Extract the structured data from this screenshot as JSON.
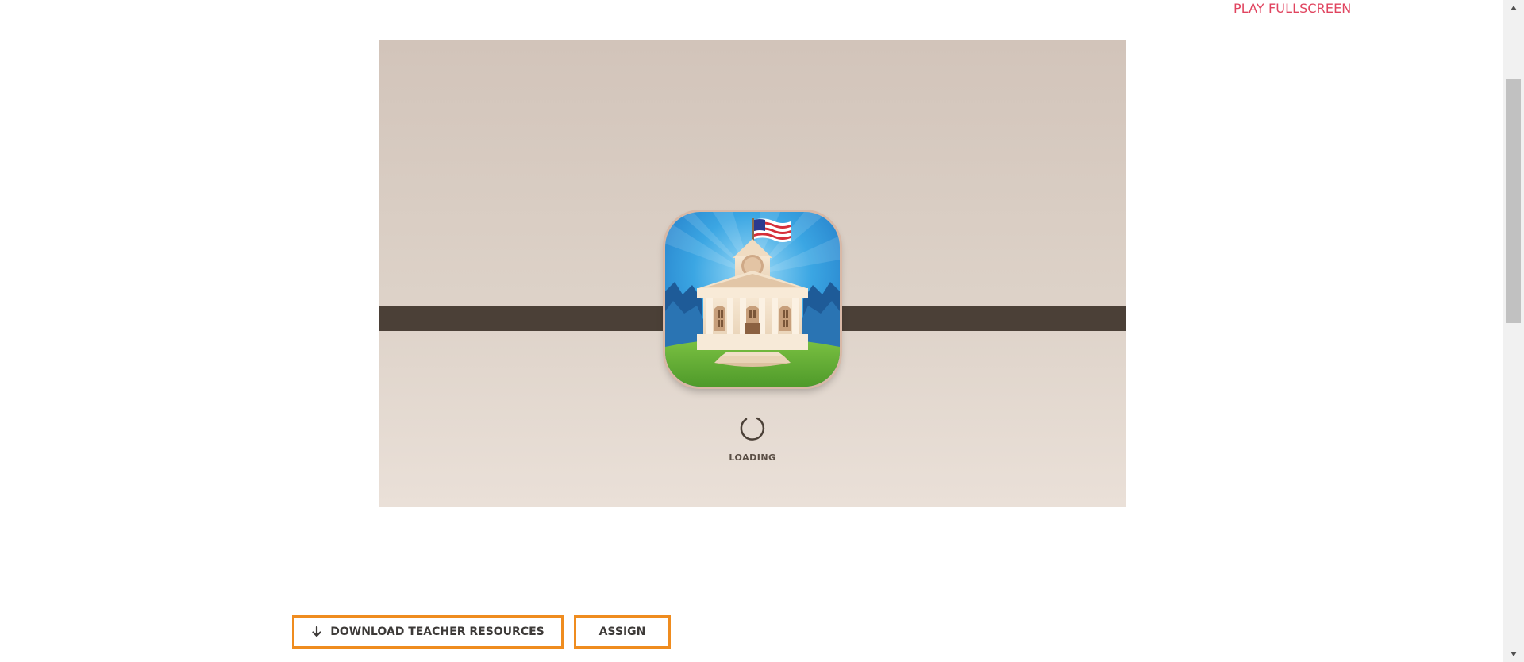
{
  "header": {
    "fullscreen_label": "PLAY FULLSCREEN"
  },
  "game": {
    "loading_label": "LOADING",
    "icon": "courthouse-app-icon",
    "spinner_icon": "loading-spinner-icon"
  },
  "actions": {
    "download_label": "DOWNLOAD TEACHER RESOURCES",
    "download_icon": "arrow-down-icon",
    "assign_label": "ASSIGN"
  },
  "colors": {
    "link": "#e0445f",
    "button_border": "#ef8c1f",
    "band": "#4b4037",
    "frame_top": "#d2c4ba",
    "frame_bottom": "#eae0d8"
  }
}
